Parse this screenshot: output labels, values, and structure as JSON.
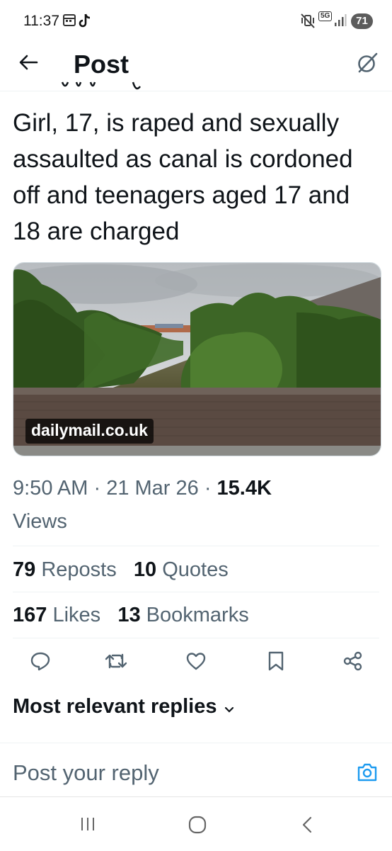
{
  "status_bar": {
    "time": "11:37",
    "network": "5G",
    "battery": "71"
  },
  "header": {
    "title": "Post"
  },
  "post": {
    "text": "Girl, 17, is raped and sexually assaulted as canal is cordoned off and teenagers aged 17 and 18 are charged",
    "card_domain": "dailymail.co.uk",
    "time": "9:50 AM",
    "date": "21 Mar 26",
    "views_count": "15.4K",
    "views_label": "Views"
  },
  "stats": {
    "reposts_count": "79",
    "reposts_label": "Reposts",
    "quotes_count": "10",
    "quotes_label": "Quotes",
    "likes_count": "167",
    "likes_label": "Likes",
    "bookmarks_count": "13",
    "bookmarks_label": "Bookmarks"
  },
  "replies": {
    "sort_label": "Most relevant replies",
    "reply_placeholder": "Post your reply"
  },
  "icons": {
    "back": "arrow-left-icon",
    "grok": "grok-icon",
    "reply": "speech-bubble-icon",
    "repost": "repost-arrows-icon",
    "like": "heart-icon",
    "bookmark": "bookmark-icon",
    "share": "share-icon",
    "camera": "camera-icon"
  },
  "colors": {
    "text_primary": "#0f1419",
    "text_secondary": "#536471",
    "accent": "#1d9bf0"
  }
}
